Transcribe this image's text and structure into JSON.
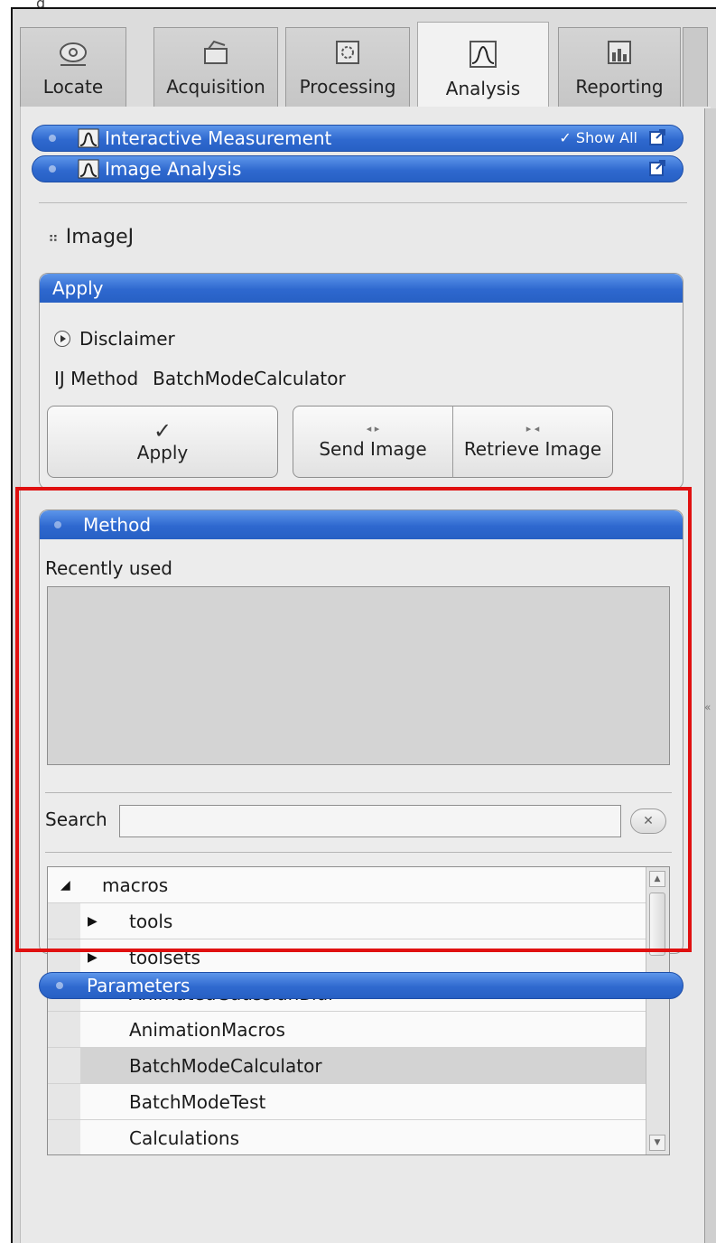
{
  "window": {
    "title_cut": "g"
  },
  "tabs": [
    {
      "label": "Locate",
      "icon": "locate-icon"
    },
    {
      "label": "Acquisition",
      "icon": "acquisition-icon"
    },
    {
      "label": "Processing",
      "icon": "processing-icon"
    },
    {
      "label": "Analysis",
      "icon": "analysis-icon",
      "active": true
    },
    {
      "label": "Reporting",
      "icon": "reporting-icon"
    }
  ],
  "sections": {
    "interactive": {
      "title": "Interactive Measurement",
      "show_all": "Show All"
    },
    "image_analysis": {
      "title": "Image Analysis"
    }
  },
  "imagej": {
    "label": "ImageJ"
  },
  "apply_group": {
    "title": "Apply",
    "disclaimer": "Disclaimer",
    "method_label": "IJ Method",
    "method_value": "BatchModeCalculator",
    "apply_button": "Apply",
    "send_button": "Send Image",
    "retrieve_button": "Retrieve Image"
  },
  "method_group": {
    "title": "Method",
    "recently_used": "Recently used",
    "search_label": "Search",
    "search_value": "",
    "tree": [
      {
        "label": "macros",
        "level": 0,
        "expander": "expanded"
      },
      {
        "label": "tools",
        "level": 1,
        "expander": "collapsed"
      },
      {
        "label": "toolsets",
        "level": 1,
        "expander": "collapsed"
      },
      {
        "label": "AnimatedGaussianBlur",
        "level": 1,
        "expander": "none"
      },
      {
        "label": "AnimationMacros",
        "level": 1,
        "expander": "none"
      },
      {
        "label": "BatchModeCalculator",
        "level": 1,
        "expander": "none",
        "selected": true
      },
      {
        "label": "BatchModeTest",
        "level": 1,
        "expander": "none"
      },
      {
        "label": "Calculations",
        "level": 1,
        "expander": "none"
      }
    ]
  },
  "parameters": {
    "title": "Parameters"
  },
  "colors": {
    "accent_blue": "#2f69cf",
    "highlight_red": "#e01010",
    "panel_gray": "#e9e9e9"
  }
}
